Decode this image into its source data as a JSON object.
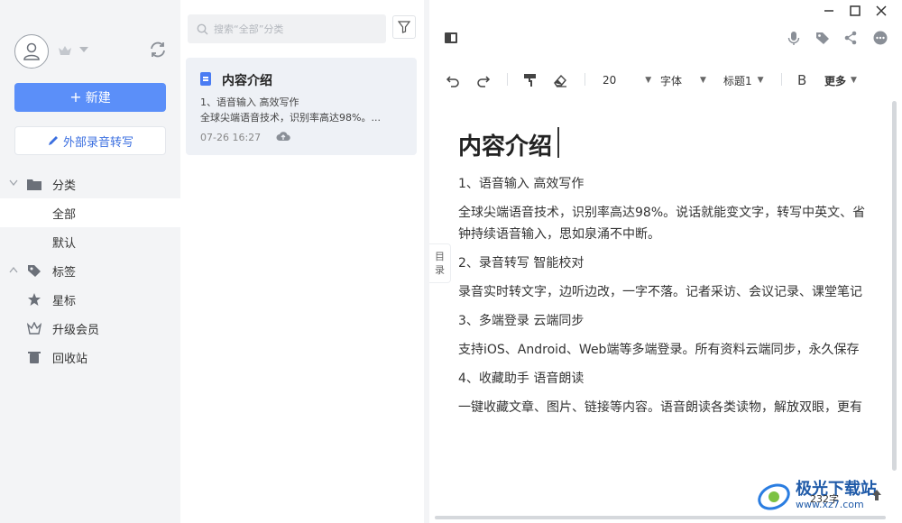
{
  "sidebar": {
    "new_label": "新建",
    "ext_label": "外部录音转写",
    "items": [
      {
        "label": "分类"
      },
      {
        "label": "全部"
      },
      {
        "label": "默认"
      },
      {
        "label": "标签"
      },
      {
        "label": "星标"
      },
      {
        "label": "升级会员"
      },
      {
        "label": "回收站"
      }
    ]
  },
  "list": {
    "search_placeholder": "搜索“全部”分类",
    "note": {
      "title": "内容介绍",
      "line1": "1、语音输入 高效写作",
      "line2": "全球尖端语音技术，识别率高达98%。...",
      "time": "07-26 16:27"
    }
  },
  "toolbar": {
    "font_size": "20",
    "font_label": "字体",
    "heading_label": "标题1",
    "bold_label": "B",
    "more_label": "更多"
  },
  "document": {
    "title": "内容介绍",
    "paragraphs": [
      "1、语音输入 高效写作",
      "全球尖端语音技术，识别率高达98%。说话就能变文字，转写中英文、省",
      "钟持续语音输入，思如泉涌不中断。",
      "2、录音转写 智能校对",
      "录音实时转文字，边听边改，一字不落。记者采访、会议记录、课堂笔记",
      "3、多端登录 云端同步",
      "支持iOS、Android、Web端等多端登录。所有资料云端同步，永久保存",
      "4、收藏助手 语音朗读",
      "一键收藏文章、图片、链接等内容。语音朗读各类读物，解放双眼，更有"
    ],
    "toc_label_1": "目",
    "toc_label_2": "录",
    "word_count": "232字"
  },
  "watermark": {
    "line1": "极光下载站",
    "line2": "www.xz7.com"
  },
  "colors": {
    "accent": "#5b8ff9",
    "link": "#3b6fe0",
    "sidebar_bg": "#f3f4f6"
  }
}
